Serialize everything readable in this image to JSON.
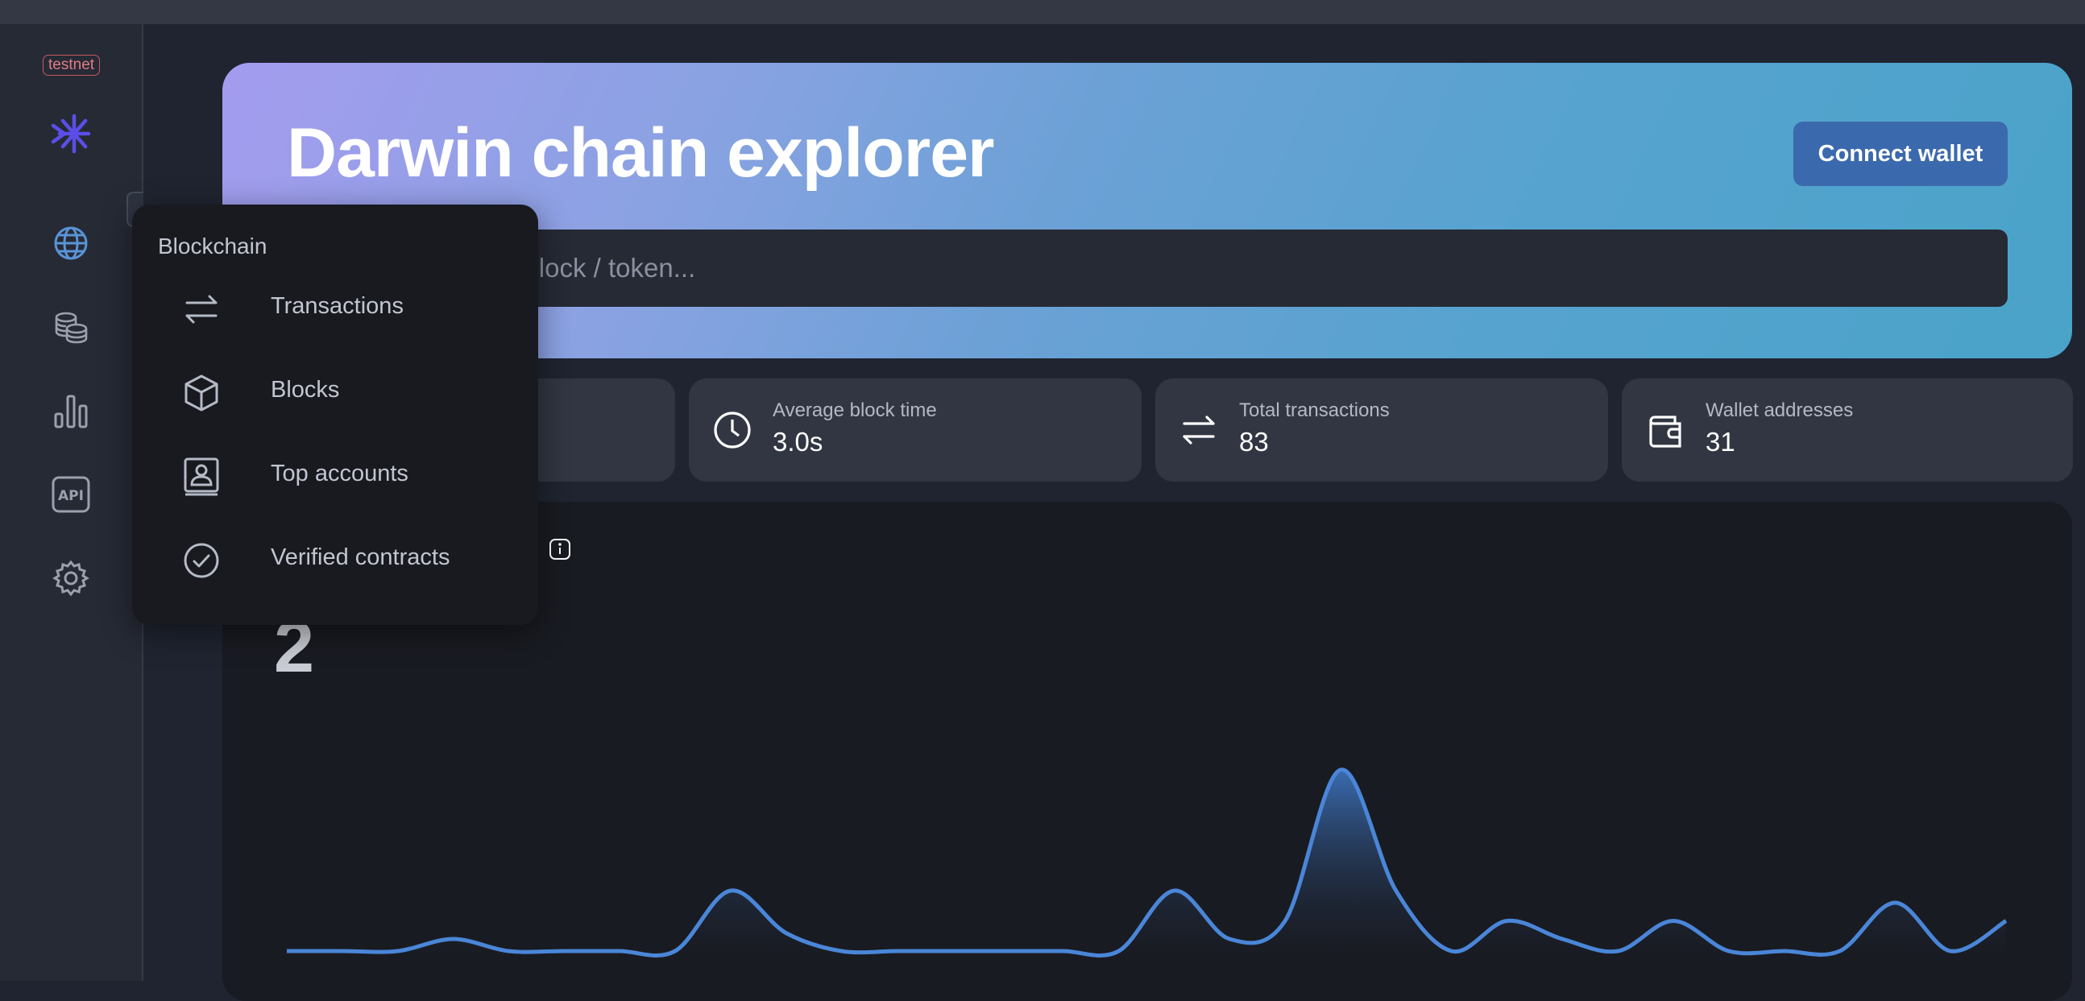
{
  "network_badge": "testnet",
  "hero": {
    "title": "Darwin chain explorer",
    "connect_label": "Connect wallet",
    "search_placeholder_visible": "dress / txn hash / block / token..."
  },
  "sidebar": {
    "icons": [
      "globe-icon",
      "coins-icon",
      "bar-chart-icon",
      "api-icon",
      "gear-icon"
    ]
  },
  "stats": [
    {
      "label": "Average block time",
      "value": "3.0s",
      "icon": "clock-icon"
    },
    {
      "label": "Total transactions",
      "value": "83",
      "icon": "transfer-arrows-icon"
    },
    {
      "label": "Wallet addresses",
      "value": "31",
      "icon": "wallet-icon"
    }
  ],
  "dropdown": {
    "title": "Blockchain",
    "items": [
      {
        "label": "Transactions",
        "icon": "transfer-arrows-icon"
      },
      {
        "label": "Blocks",
        "icon": "cube-icon"
      },
      {
        "label": "Top accounts",
        "icon": "account-icon"
      },
      {
        "label": "Verified contracts",
        "icon": "check-circle-icon"
      }
    ]
  },
  "chart": {
    "current_value": "2"
  },
  "chart_data": {
    "type": "area",
    "x": [
      0,
      1,
      2,
      3,
      4,
      5,
      6,
      7,
      8,
      9,
      10,
      11,
      12,
      13,
      14,
      15,
      16,
      17,
      18,
      19,
      20,
      21,
      22,
      23,
      24,
      25,
      26,
      27,
      28,
      29,
      30
    ],
    "values": [
      0,
      0,
      0,
      0.2,
      0,
      0,
      0,
      0,
      1,
      0.3,
      0,
      0,
      0,
      0,
      0,
      0,
      1,
      0.2,
      0.5,
      3,
      1,
      0,
      0.5,
      0.2,
      0,
      0.5,
      0,
      0,
      0,
      0.8,
      0,
      0.5
    ],
    "colors": {
      "line": "#4a86d8",
      "fill_top": "#3c70b8",
      "fill_bottom": "#1a1d26"
    }
  }
}
